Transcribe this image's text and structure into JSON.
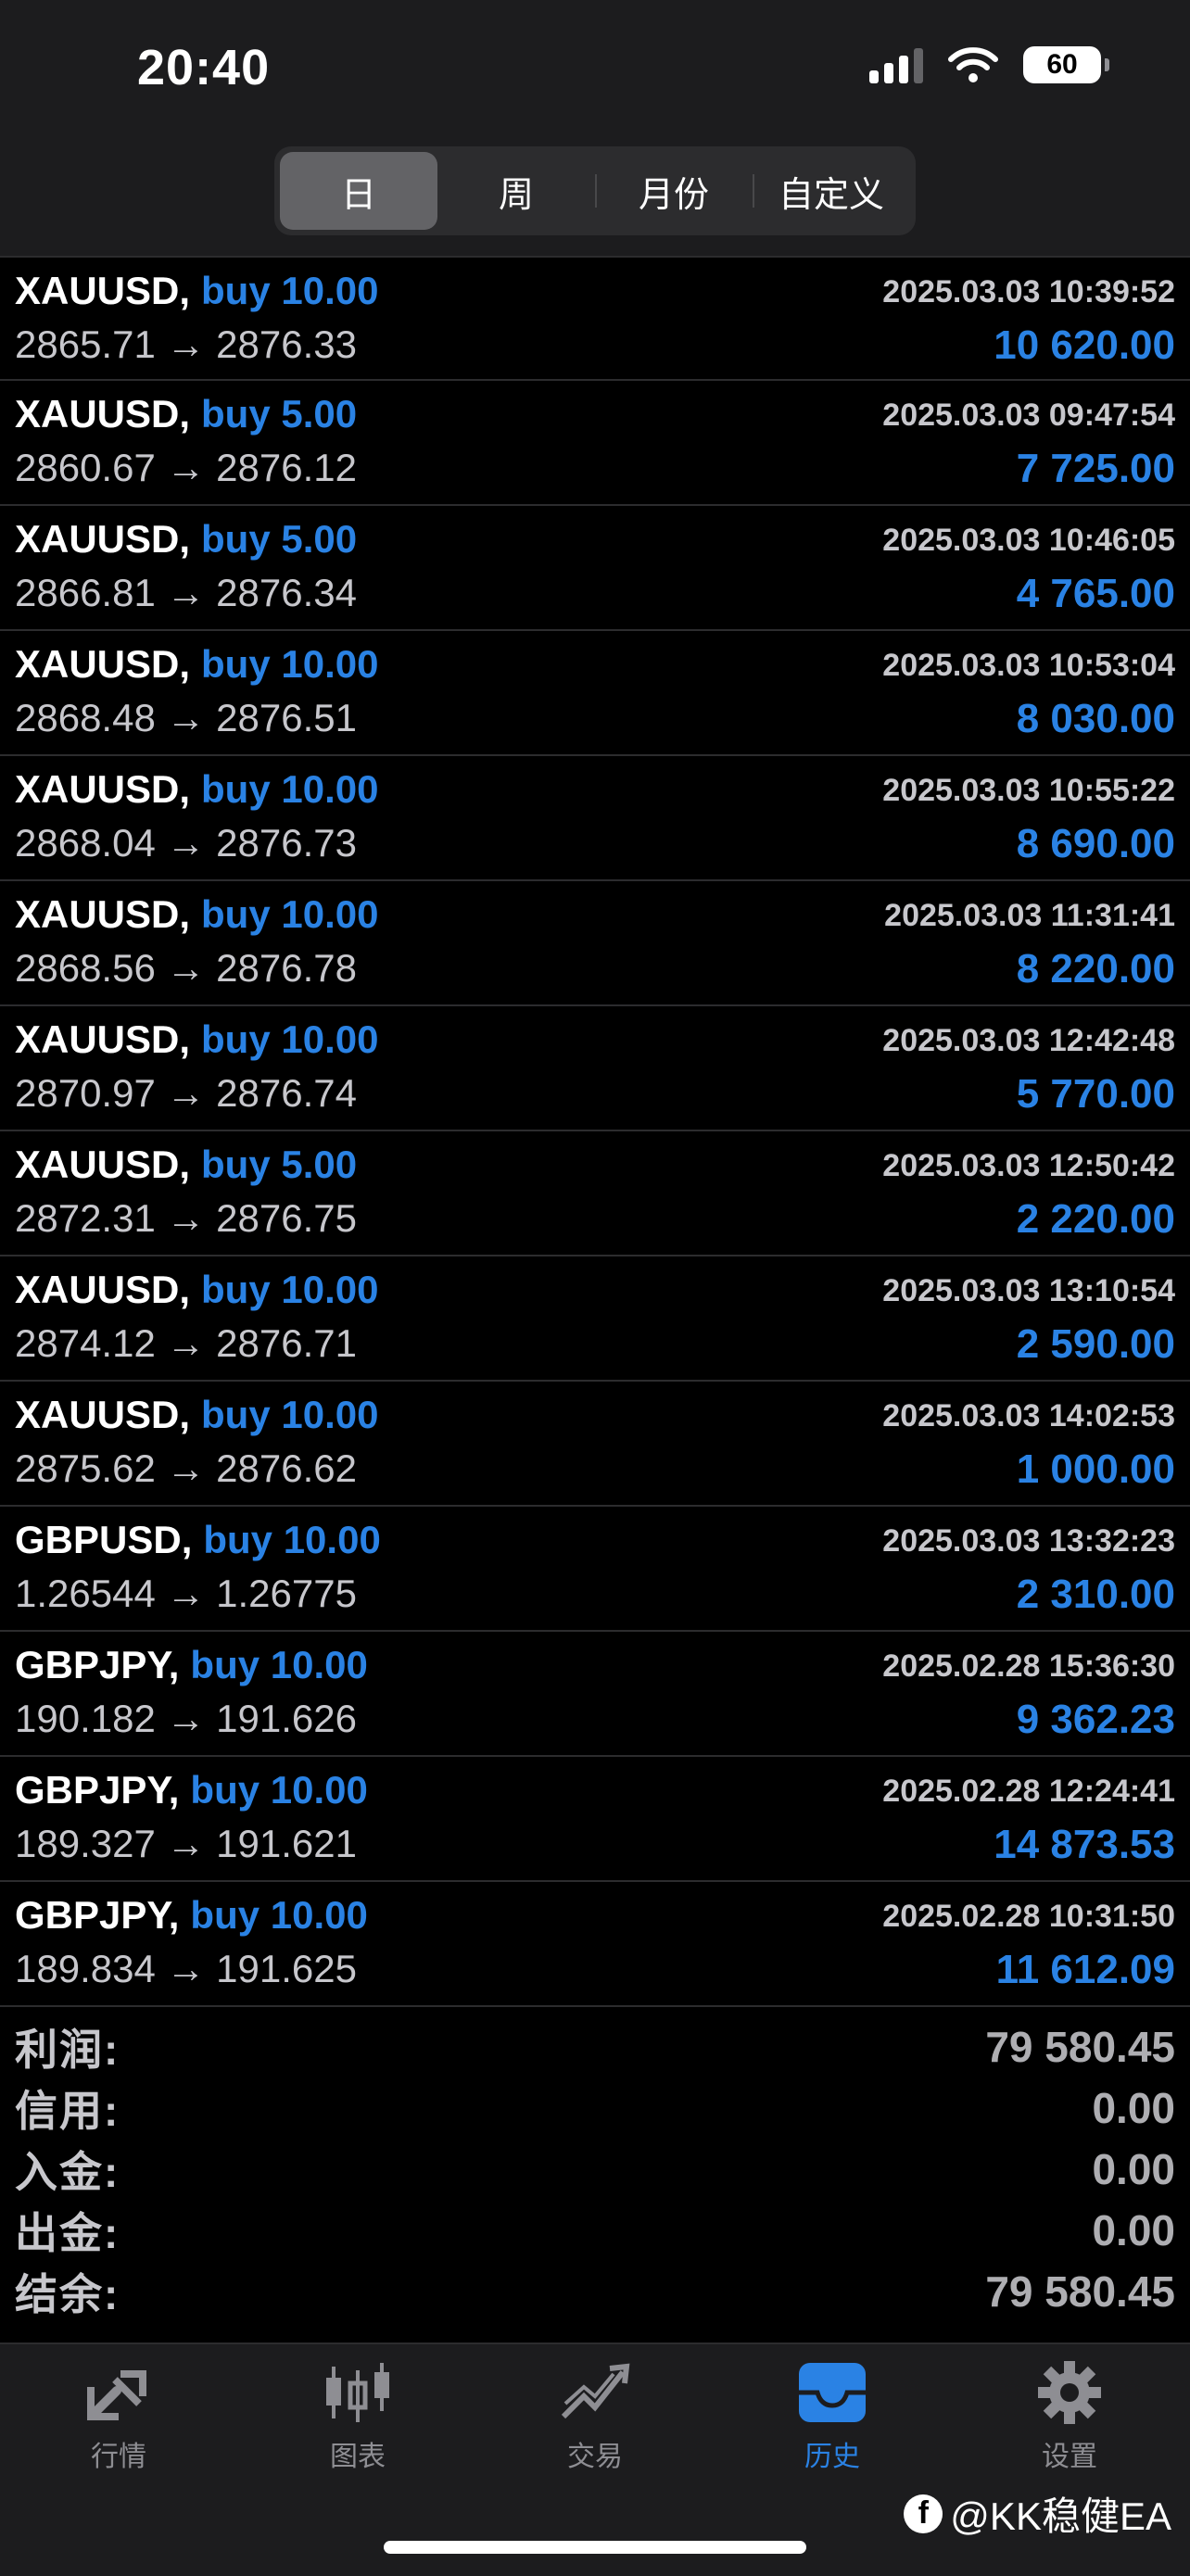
{
  "status": {
    "time": "20:40",
    "battery": "60"
  },
  "segments": [
    "日",
    "周",
    "月份",
    "自定义"
  ],
  "trades": [
    {
      "symbol": "XAUUSD,",
      "side": "buy 10.00",
      "date": "2025.03.03 10:39:52",
      "prices": "2865.71 → 2876.33",
      "profit": "10 620.00"
    },
    {
      "symbol": "XAUUSD,",
      "side": "buy 5.00",
      "date": "2025.03.03 09:47:54",
      "prices": "2860.67 → 2876.12",
      "profit": "7 725.00"
    },
    {
      "symbol": "XAUUSD,",
      "side": "buy 5.00",
      "date": "2025.03.03 10:46:05",
      "prices": "2866.81 → 2876.34",
      "profit": "4 765.00"
    },
    {
      "symbol": "XAUUSD,",
      "side": "buy 10.00",
      "date": "2025.03.03 10:53:04",
      "prices": "2868.48 → 2876.51",
      "profit": "8 030.00"
    },
    {
      "symbol": "XAUUSD,",
      "side": "buy 10.00",
      "date": "2025.03.03 10:55:22",
      "prices": "2868.04 → 2876.73",
      "profit": "8 690.00"
    },
    {
      "symbol": "XAUUSD,",
      "side": "buy 10.00",
      "date": "2025.03.03 11:31:41",
      "prices": "2868.56 → 2876.78",
      "profit": "8 220.00"
    },
    {
      "symbol": "XAUUSD,",
      "side": "buy 10.00",
      "date": "2025.03.03 12:42:48",
      "prices": "2870.97 → 2876.74",
      "profit": "5 770.00"
    },
    {
      "symbol": "XAUUSD,",
      "side": "buy 5.00",
      "date": "2025.03.03 12:50:42",
      "prices": "2872.31 → 2876.75",
      "profit": "2 220.00"
    },
    {
      "symbol": "XAUUSD,",
      "side": "buy 10.00",
      "date": "2025.03.03 13:10:54",
      "prices": "2874.12 → 2876.71",
      "profit": "2 590.00"
    },
    {
      "symbol": "XAUUSD,",
      "side": "buy 10.00",
      "date": "2025.03.03 14:02:53",
      "prices": "2875.62 → 2876.62",
      "profit": "1 000.00"
    },
    {
      "symbol": "GBPUSD,",
      "side": "buy 10.00",
      "date": "2025.03.03 13:32:23",
      "prices": "1.26544 → 1.26775",
      "profit": "2 310.00"
    },
    {
      "symbol": "GBPJPY,",
      "side": "buy 10.00",
      "date": "2025.02.28 15:36:30",
      "prices": "190.182 → 191.626",
      "profit": "9 362.23"
    },
    {
      "symbol": "GBPJPY,",
      "side": "buy 10.00",
      "date": "2025.02.28 12:24:41",
      "prices": "189.327 → 191.621",
      "profit": "14 873.53"
    },
    {
      "symbol": "GBPJPY,",
      "side": "buy 10.00",
      "date": "2025.02.28 10:31:50",
      "prices": "189.834 → 191.625",
      "profit": "11 612.09"
    }
  ],
  "summary": [
    {
      "label": "利润:",
      "value": "79 580.45"
    },
    {
      "label": "信用:",
      "value": "0.00"
    },
    {
      "label": "入金:",
      "value": "0.00"
    },
    {
      "label": "出金:",
      "value": "0.00"
    },
    {
      "label": "结余:",
      "value": "79 580.45"
    }
  ],
  "tabs": [
    {
      "label": "行情",
      "icon": "quotes-arrows-icon"
    },
    {
      "label": "图表",
      "icon": "candlestick-chart-icon"
    },
    {
      "label": "交易",
      "icon": "trade-chart-icon"
    },
    {
      "label": "历史",
      "icon": "history-inbox-icon"
    },
    {
      "label": "设置",
      "icon": "gear-icon"
    }
  ],
  "colors": {
    "accent": "#2a82e4",
    "background": "#000000",
    "bar": "#1c1c1e"
  },
  "watermark": "@KK稳健EA"
}
